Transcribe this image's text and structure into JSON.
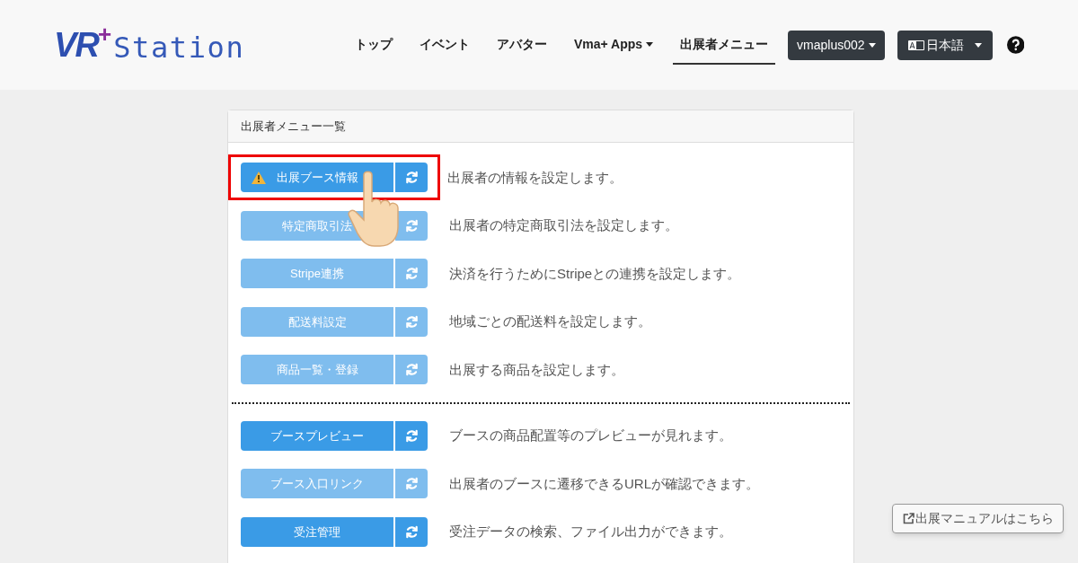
{
  "logo": {
    "mark": "VR",
    "plus": "+",
    "name": "Station"
  },
  "nav": [
    {
      "label": "トップ",
      "selected": false,
      "dropdown": false
    },
    {
      "label": "イベント",
      "selected": false,
      "dropdown": false
    },
    {
      "label": "アバター",
      "selected": false,
      "dropdown": false
    },
    {
      "label": "Vma+ Apps",
      "selected": false,
      "dropdown": true
    },
    {
      "label": "出展者メニュー",
      "selected": true,
      "dropdown": false
    }
  ],
  "user_menu": {
    "label": "vmaplus002"
  },
  "language_menu": {
    "label": "日本語"
  },
  "card": {
    "title": "出展者メニュー一覧",
    "sections": [
      {
        "items": [
          {
            "label": "出展ブース情報",
            "description": "出展者の情報を設定します。",
            "disabled": false,
            "warning": true,
            "highlighted": true
          },
          {
            "label": "特定商取引法",
            "description": "出展者の特定商取引法を設定します。",
            "disabled": true,
            "warning": false,
            "highlighted": false
          },
          {
            "label": "Stripe連携",
            "description": "決済を行うためにStripeとの連携を設定します。",
            "disabled": true,
            "warning": false,
            "highlighted": false
          },
          {
            "label": "配送料設定",
            "description": "地域ごとの配送料を設定します。",
            "disabled": true,
            "warning": false,
            "highlighted": false
          },
          {
            "label": "商品一覧・登録",
            "description": "出展する商品を設定します。",
            "disabled": true,
            "warning": false,
            "highlighted": false
          }
        ]
      },
      {
        "items": [
          {
            "label": "ブースプレビュー",
            "description": "ブースの商品配置等のプレビューが見れます。",
            "disabled": false,
            "warning": false,
            "highlighted": false
          },
          {
            "label": "ブース入口リンク",
            "description": "出展者のブースに遷移できるURLが確認できます。",
            "disabled": true,
            "warning": false,
            "highlighted": false
          },
          {
            "label": "受注管理",
            "description": "受注データの検索、ファイル出力ができます。",
            "disabled": false,
            "warning": false,
            "highlighted": false
          }
        ]
      }
    ]
  },
  "manual_button": {
    "label": "出展マニュアルはこちら"
  }
}
